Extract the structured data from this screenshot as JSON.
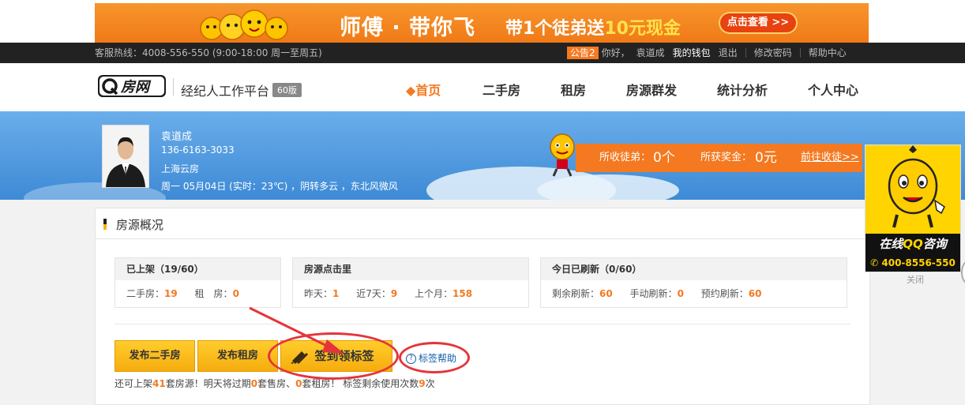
{
  "banner": {
    "main_text": "师傅 · 带你飞",
    "sub_pre": "带1个徒弟送",
    "sub_amount": "10元现金",
    "button": "点击查看 >>"
  },
  "topbar": {
    "hotline": "客服热线：4008-556-550 (9:00-18:00 周一至周五)",
    "notice": "公告2",
    "greeting": "你好，",
    "username": "袁道成",
    "wallet": "我的钱包",
    "logout": "退出",
    "change_password": "修改密码",
    "help_center": "帮助中心"
  },
  "header": {
    "logo_text": "Q房网",
    "platform": "经纪人工作平台",
    "version": "60版",
    "nav": [
      "◆首页",
      "二手房",
      "租房",
      "房源群发",
      "统计分析",
      "个人中心"
    ]
  },
  "profile": {
    "name": "袁道成",
    "phone": "136-6163-3033",
    "company": "上海云房",
    "weather": "周一 05月04日 (实时：23℃) ，阴转多云 ，东北风微风",
    "apprentices_label": "所收徒弟：",
    "apprentices_value": "0个",
    "bonus_label": "所获奖金：",
    "bonus_value": "0元",
    "collect_link": "前往收徒>>"
  },
  "overview": {
    "title": "房源概况",
    "listed": {
      "header": "已上架（19/60）",
      "second_label": "二手房：",
      "second_value": "19",
      "rent_label": "租　房：",
      "rent_value": "0"
    },
    "clicks": {
      "header": "房源点击里",
      "yesterday_label": "昨天：",
      "yesterday_value": "1",
      "week_label": "近7天：",
      "week_value": "9",
      "month_label": "上个月：",
      "month_value": "158"
    },
    "refresh": {
      "header": "今日已刷新（0/60）",
      "remain_label": "剩余刷新：",
      "remain_value": "60",
      "manual_label": "手动刷新：",
      "manual_value": "0",
      "scheduled_label": "预约刷新：",
      "scheduled_value": "60"
    }
  },
  "actions": {
    "publish_second": "发布二手房",
    "publish_rent": "发布租房",
    "sign_in": "签到领标签",
    "tag_help": "标签帮助"
  },
  "status": {
    "p1": "还可上架",
    "n1": "41",
    "p2": "套房源！明天将过期",
    "n2": "0",
    "p3": "套售房、",
    "n3": "0",
    "p4": "套租房！ 标签剩余使用次数",
    "n4": "9",
    "p5": "次"
  },
  "qq_widget": {
    "title_prefix": "在线",
    "title_qq": "QQ",
    "title_suffix": "咨询",
    "phone": "✆ 400-8556-550",
    "close": "关闭"
  },
  "colors": {
    "accent": "#f47920",
    "topbar": "#222222",
    "annotation_red": "#e5343a",
    "button_yellow": "#ffcd2c"
  }
}
